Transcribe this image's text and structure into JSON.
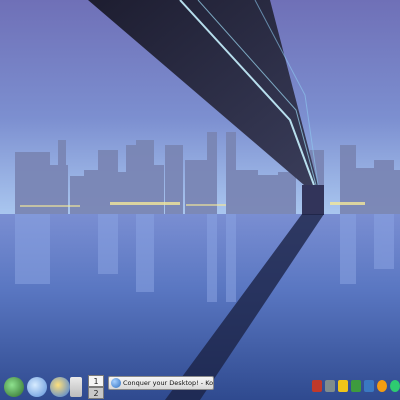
{
  "pager": {
    "desk1": "1",
    "desk2": "2"
  },
  "taskbar": {
    "active_task_title": "Conquer your Desktop! - Konqu"
  },
  "launchers": [
    {
      "name": "kde-menu-icon",
      "color": "#2e6b2a"
    },
    {
      "name": "home-folder-icon",
      "color": "#5b8fd8"
    },
    {
      "name": "konqueror-browser-icon",
      "color": "#3b7be0"
    },
    {
      "name": "show-desktop-icon",
      "color": "#d6d6d6"
    }
  ],
  "systray": [
    {
      "name": "tray-audio-icon",
      "color": "#c0392b"
    },
    {
      "name": "tray-network-icon",
      "color": "#7f8c8d"
    },
    {
      "name": "tray-clipboard-icon",
      "color": "#f0c419"
    },
    {
      "name": "tray-update-icon",
      "color": "#3e9b3e"
    },
    {
      "name": "tray-printer-icon",
      "color": "#3a78c2"
    },
    {
      "name": "tray-kmix-icon",
      "color": "#f39c12"
    },
    {
      "name": "tray-clock-icon",
      "color": "#2ecc71"
    }
  ],
  "colors": {
    "sky_top": "#6d73b8",
    "sky_mid": "#7f8fd0",
    "horizon": "#a8c5ee",
    "water_top": "#5e7ec8",
    "water_bottom": "#3d559a",
    "bridge": "#2b2c45",
    "bridge_lights": "#c7f2ff"
  }
}
